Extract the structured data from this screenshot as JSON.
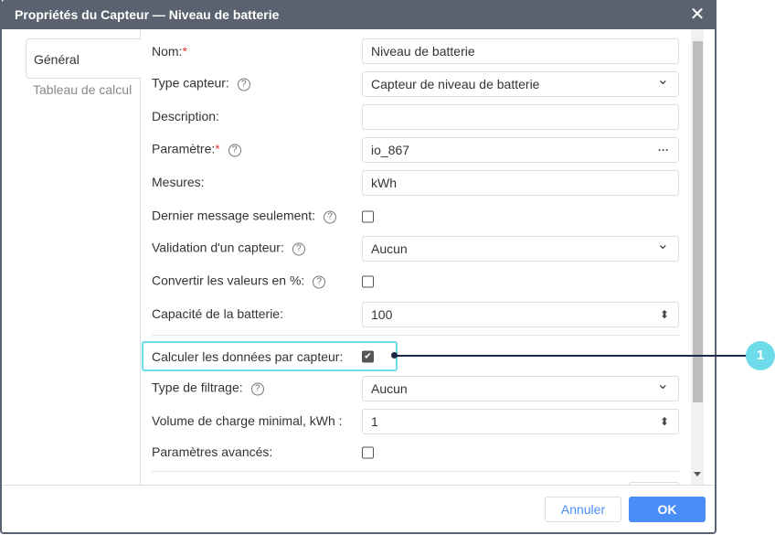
{
  "dialog": {
    "title": "Propriétés du Capteur — Niveau de batterie",
    "close": "✕"
  },
  "tabs": [
    {
      "label": "Général"
    },
    {
      "label": "Tableau de calcul"
    }
  ],
  "form": {
    "name": {
      "label": "Nom:",
      "req": "*",
      "value": "Niveau de batterie"
    },
    "type": {
      "label": "Type capteur:",
      "value": "Capteur de niveau de batterie"
    },
    "description": {
      "label": "Description:",
      "value": ""
    },
    "param": {
      "label": "Paramètre:",
      "req": "*",
      "value": "io_867",
      "more": "···"
    },
    "units": {
      "label": "Mesures:",
      "value": "kWh"
    },
    "last_msg": {
      "label": "Dernier message seulement:",
      "checked": false
    },
    "validation": {
      "label": "Validation d'un capteur:",
      "value": "Aucun"
    },
    "convert": {
      "label": "Convertir les valeurs en %:",
      "checked": false
    },
    "capacity": {
      "label": "Capacité de la batterie:",
      "value": "100"
    },
    "calc": {
      "label": "Calculer les données par capteur:",
      "checked": true
    },
    "filter": {
      "label": "Type de filtrage:",
      "value": "Aucun"
    },
    "min_charge": {
      "label": "Volume de charge minimal, kWh :",
      "value": "1"
    },
    "advanced": {
      "label": "Paramètres avancés:",
      "checked": false
    }
  },
  "help": "?",
  "chevron": "⌄",
  "spinner": "⬍",
  "check": "✔",
  "buttons": {
    "cancel": "Annuler",
    "ok": "OK"
  },
  "callout": {
    "number": "1",
    "color": "#6ddbe9"
  }
}
